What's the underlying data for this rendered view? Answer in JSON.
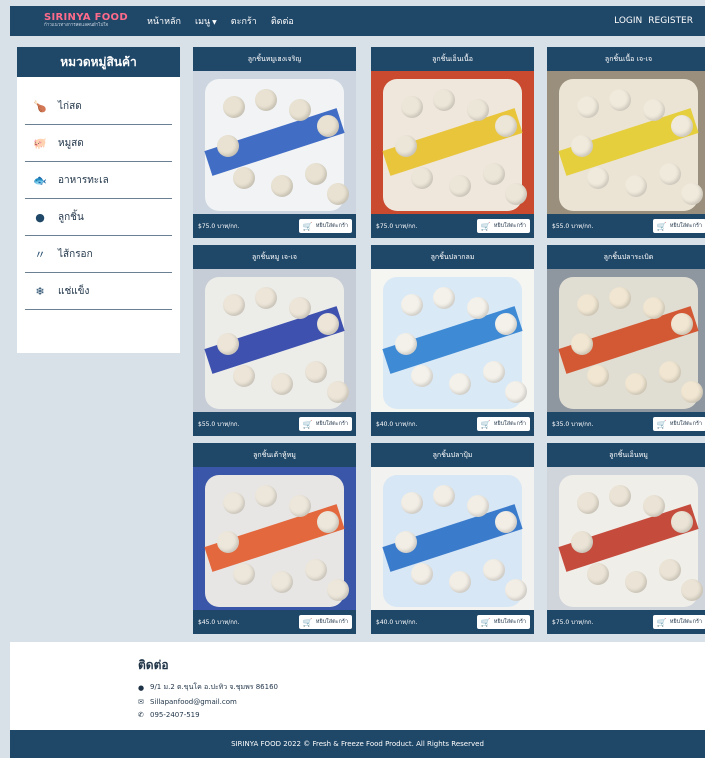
{
  "navbar": {
    "brand": "SIRINYA FOOD",
    "brand_sub": "ก้าวแนวทางการสดแลคนผ้าไปใจ",
    "links": [
      "หน้าหลัก",
      "เมนู",
      "ตะกร้า",
      "ติดต่อ"
    ],
    "login": "LOGIN",
    "register": "REGISTER"
  },
  "sidebar": {
    "title": "หมวดหมู่สินค้า",
    "items": [
      {
        "label": "ไก่สด",
        "icon": "chicken-leg-icon",
        "glyph": "🍗"
      },
      {
        "label": "หมูสด",
        "icon": "pig-icon",
        "glyph": "🐖"
      },
      {
        "label": "อาหารทะเล",
        "icon": "fish-icon",
        "glyph": "🐟"
      },
      {
        "label": "ลูกชิ้น",
        "icon": "circle-icon",
        "glyph": "●"
      },
      {
        "label": "ไส้กรอก",
        "icon": "sausage-icon",
        "glyph": "〃"
      },
      {
        "label": "แช่แข็ง",
        "icon": "snowflake-icon",
        "glyph": "❄"
      }
    ]
  },
  "products": [
    {
      "title": "ลูกชิ้นหมูเฮงเจริญ",
      "price": "$75.0 บาท/กก.",
      "cart": "หยิบใส่ตะกร้า"
    },
    {
      "title": "ลูกชิ้นเอ็นเนื้อ",
      "price": "$75.0 บาท/กก.",
      "cart": "หยิบใส่ตะกร้า"
    },
    {
      "title": "ลูกชิ้นเนื้อ เจ-เจ",
      "price": "$55.0 บาท/กก.",
      "cart": "หยิบใส่ตะกร้า"
    },
    {
      "title": "ลูกชิ้นหมู เจ-เจ",
      "price": "$55.0 บาท/กก.",
      "cart": "หยิบใส่ตะกร้า"
    },
    {
      "title": "ลูกชิ้นปลากลม",
      "price": "$40.0 บาท/กก.",
      "cart": "หยิบใส่ตะกร้า"
    },
    {
      "title": "ลูกชิ้นปลาระเบิด",
      "price": "$35.0 บาท/กก.",
      "cart": "หยิบใส่ตะกร้า"
    },
    {
      "title": "ลูกชิ้นเต้าหู้หมู",
      "price": "$45.0 บาท/กก.",
      "cart": "หยิบใส่ตะกร้า"
    },
    {
      "title": "ลูกชิ้นปลาปุ้ม",
      "price": "$40.0 บาท/กก.",
      "cart": "หยิบใส่ตะกร้า"
    },
    {
      "title": "ลูกชิ้นเอ็นหมู",
      "price": "$75.0 บาท/กก.",
      "cart": "หยิบใส่ตะกร้า"
    }
  ],
  "contact": {
    "title": "ติดต่อ",
    "address": "9/1 ม.2 ต.ขุนโค อ.ปะทิว จ.ชุมพร 86160",
    "email": "Sillapanfood@gmail.com",
    "phone": "095-2407-519"
  },
  "footer": {
    "text": "SIRINYA FOOD 2022 © Fresh & Freeze Food Product. All Rights Reserved"
  },
  "colors": {
    "navy": "#1f4768",
    "brand_pink": "#ff6b8a",
    "page_bg": "#d9e1e8"
  }
}
